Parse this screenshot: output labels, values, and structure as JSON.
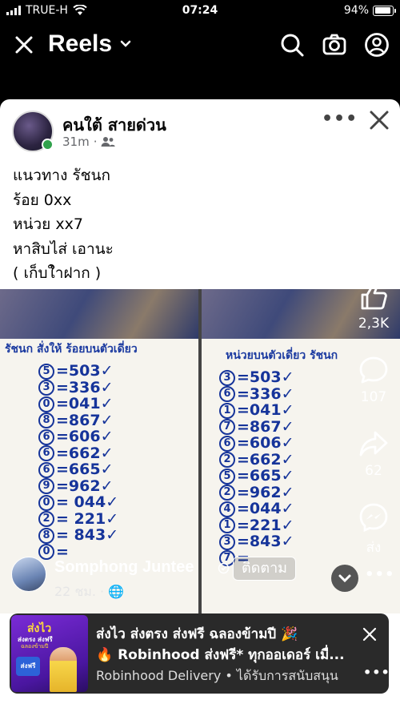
{
  "status_bar": {
    "carrier": "TRUE-H",
    "time": "07:24",
    "battery": "94%",
    "battery_level": 0.94
  },
  "header": {
    "title": "Reels"
  },
  "post": {
    "page_name": "คนใต้ สายด่วน",
    "time": "31m",
    "caption": [
      "แนวทาง รัชนก",
      "ร้อย 0xx",
      "หน่วย xx7",
      "หาสิบไส่ เอานะ",
      "( เก็บใำฝาก )"
    ]
  },
  "photo_left": {
    "heading": "รัชนก สั่งให้   ร้อยบนตัวเดี่ยว",
    "rows": [
      {
        "c": "5",
        "v": "=503✓"
      },
      {
        "c": "3",
        "v": "=336✓"
      },
      {
        "c": "0",
        "v": "=041✓"
      },
      {
        "c": "8",
        "v": "=867✓"
      },
      {
        "c": "6",
        "v": "=606✓"
      },
      {
        "c": "6",
        "v": "=662✓"
      },
      {
        "c": "6",
        "v": "=665✓"
      },
      {
        "c": "9",
        "v": "=962✓"
      },
      {
        "c": "0",
        "v": "= 044✓"
      },
      {
        "c": "2",
        "v": "= 221✓"
      },
      {
        "c": "8",
        "v": "= 843✓"
      },
      {
        "c": "0",
        "v": "="
      }
    ]
  },
  "photo_right": {
    "heading": "หน่วยบนตัวเดี่ยว รัชนก",
    "rows": [
      {
        "c": "3",
        "v": "=503✓"
      },
      {
        "c": "6",
        "v": "=336✓"
      },
      {
        "c": "1",
        "v": "=041✓"
      },
      {
        "c": "7",
        "v": "=867✓"
      },
      {
        "c": "6",
        "v": "=606✓"
      },
      {
        "c": "2",
        "v": "=662✓"
      },
      {
        "c": "5",
        "v": "=665✓"
      },
      {
        "c": "2",
        "v": "=962✓"
      },
      {
        "c": "4",
        "v": "=044✓"
      },
      {
        "c": "1",
        "v": "=221✓"
      },
      {
        "c": "3",
        "v": "=843✓"
      },
      {
        "c": "7",
        "v": "="
      }
    ]
  },
  "actions": {
    "likes": "2,3K",
    "comments": "107",
    "shares": "62",
    "send_label": "ส่ง"
  },
  "author": {
    "name": "Somphong Juntee",
    "follow_label": "ติดตาม",
    "time": "22 ชม."
  },
  "ad": {
    "thumb_title": "ส่งไว",
    "thumb_sub": "ส่งตรง ส่งฟรี",
    "thumb_sub2": "ฉลองข้ามปี",
    "thumb_badge": "ส่งฟรี",
    "line1": "ส่งไว ส่งตรง ส่งฟรี ฉลองข้ามปี 🎉",
    "line2": "🔥 Robinhood ส่งฟรี* ทุกออเดอร์ เมื่...",
    "line3": "Robinhood Delivery • ได้รับการสนับสนุน"
  }
}
